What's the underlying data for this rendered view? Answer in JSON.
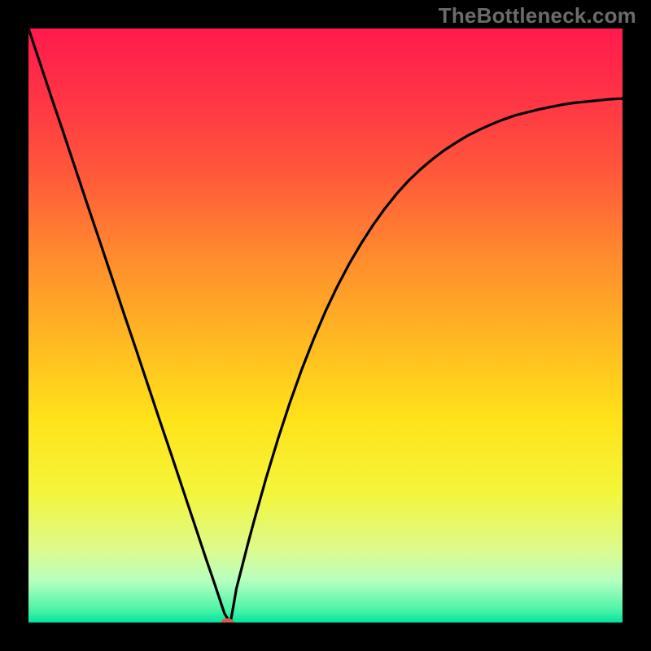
{
  "watermark": "TheBottleneck.com",
  "chart_data": {
    "type": "line",
    "title": "",
    "xlabel": "",
    "ylabel": "",
    "xlim": [
      0,
      1
    ],
    "ylim": [
      0,
      1
    ],
    "background_gradient": {
      "stops": [
        {
          "offset": 0.0,
          "color": "#ff1a4d"
        },
        {
          "offset": 0.12,
          "color": "#ff3545"
        },
        {
          "offset": 0.25,
          "color": "#ff5a3a"
        },
        {
          "offset": 0.38,
          "color": "#ff8a2e"
        },
        {
          "offset": 0.52,
          "color": "#ffb722"
        },
        {
          "offset": 0.66,
          "color": "#ffe31a"
        },
        {
          "offset": 0.78,
          "color": "#f4f53a"
        },
        {
          "offset": 0.88,
          "color": "#dcfb8f"
        },
        {
          "offset": 0.93,
          "color": "#b6ffc0"
        },
        {
          "offset": 0.98,
          "color": "#49f3a6"
        },
        {
          "offset": 1.0,
          "color": "#00e3a3"
        }
      ]
    },
    "curve_samples": {
      "x": [
        0.0,
        0.02,
        0.04,
        0.06,
        0.08,
        0.1,
        0.12,
        0.14,
        0.16,
        0.18,
        0.2,
        0.22,
        0.24,
        0.26,
        0.28,
        0.3,
        0.31,
        0.32,
        0.33,
        0.335,
        0.34,
        0.345,
        0.35,
        0.36,
        0.37,
        0.38,
        0.4,
        0.42,
        0.44,
        0.46,
        0.48,
        0.5,
        0.52,
        0.54,
        0.56,
        0.58,
        0.6,
        0.62,
        0.64,
        0.66,
        0.68,
        0.7,
        0.72,
        0.74,
        0.76,
        0.78,
        0.8,
        0.82,
        0.84,
        0.86,
        0.88,
        0.9,
        0.92,
        0.94,
        0.96,
        0.98,
        1.0
      ],
      "y": [
        1.0,
        0.94,
        0.88,
        0.821,
        0.761,
        0.701,
        0.642,
        0.582,
        0.522,
        0.463,
        0.403,
        0.343,
        0.284,
        0.224,
        0.164,
        0.104,
        0.075,
        0.045,
        0.015,
        0.007,
        0.0,
        0.028,
        0.057,
        0.096,
        0.135,
        0.172,
        0.243,
        0.309,
        0.37,
        0.426,
        0.477,
        0.524,
        0.566,
        0.604,
        0.638,
        0.669,
        0.697,
        0.722,
        0.744,
        0.763,
        0.78,
        0.795,
        0.808,
        0.82,
        0.83,
        0.839,
        0.847,
        0.854,
        0.859,
        0.864,
        0.868,
        0.872,
        0.875,
        0.877,
        0.879,
        0.881,
        0.882
      ]
    },
    "marker": {
      "x": 0.335,
      "y": 0.0,
      "rx": 0.011,
      "ry": 0.007,
      "color": "#d85a4a"
    }
  }
}
